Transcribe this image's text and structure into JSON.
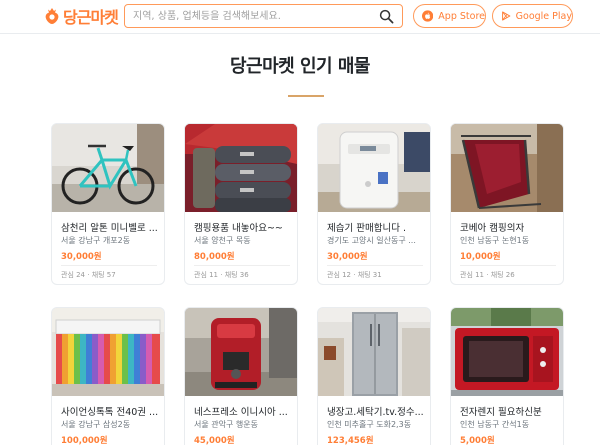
{
  "header": {
    "logo_text": "당근마켓",
    "search_placeholder": "지역, 상품, 업체등을 검색해보세요.",
    "app_store_label": "App Store",
    "google_play_label": "Google Play"
  },
  "section": {
    "title": "당근마켓 인기 매물"
  },
  "colors": {
    "brand": "#ff7e36"
  },
  "items": [
    {
      "title": "삼천리 알톤 미니벨로 ...",
      "region": "서울 강남구 개포2동",
      "price": "30,000원",
      "meta": "관심 24 · 채팅 57"
    },
    {
      "title": "캠핑용품 내놓아요~~",
      "region": "서울 양천구 목동",
      "price": "80,000원",
      "meta": "관심 11 · 채팅 36"
    },
    {
      "title": "제습기 판매합니다 .",
      "region": "경기도 고양시 일산동구 ...",
      "price": "30,000원",
      "meta": "관심 12 · 채팅 31"
    },
    {
      "title": "코베아 캠핑의자",
      "region": "인천 남동구 논현1동",
      "price": "10,000원",
      "meta": "관심 11 · 채팅 26"
    },
    {
      "title": "사이언싱톡톡 전40권 ...",
      "region": "서울 강남구 삼성2동",
      "price": "100,000원",
      "meta": ""
    },
    {
      "title": "네스프레소 이니시아 ...",
      "region": "서울 관악구 행운동",
      "price": "45,000원",
      "meta": ""
    },
    {
      "title": "냉장고.세탁기.tv.정수...",
      "region": "인천 미추홀구 도화2,3동",
      "price": "123,456원",
      "meta": ""
    },
    {
      "title": "전자렌지 필요하신분",
      "region": "인천 남동구 간석1동",
      "price": "5,000원",
      "meta": ""
    }
  ]
}
